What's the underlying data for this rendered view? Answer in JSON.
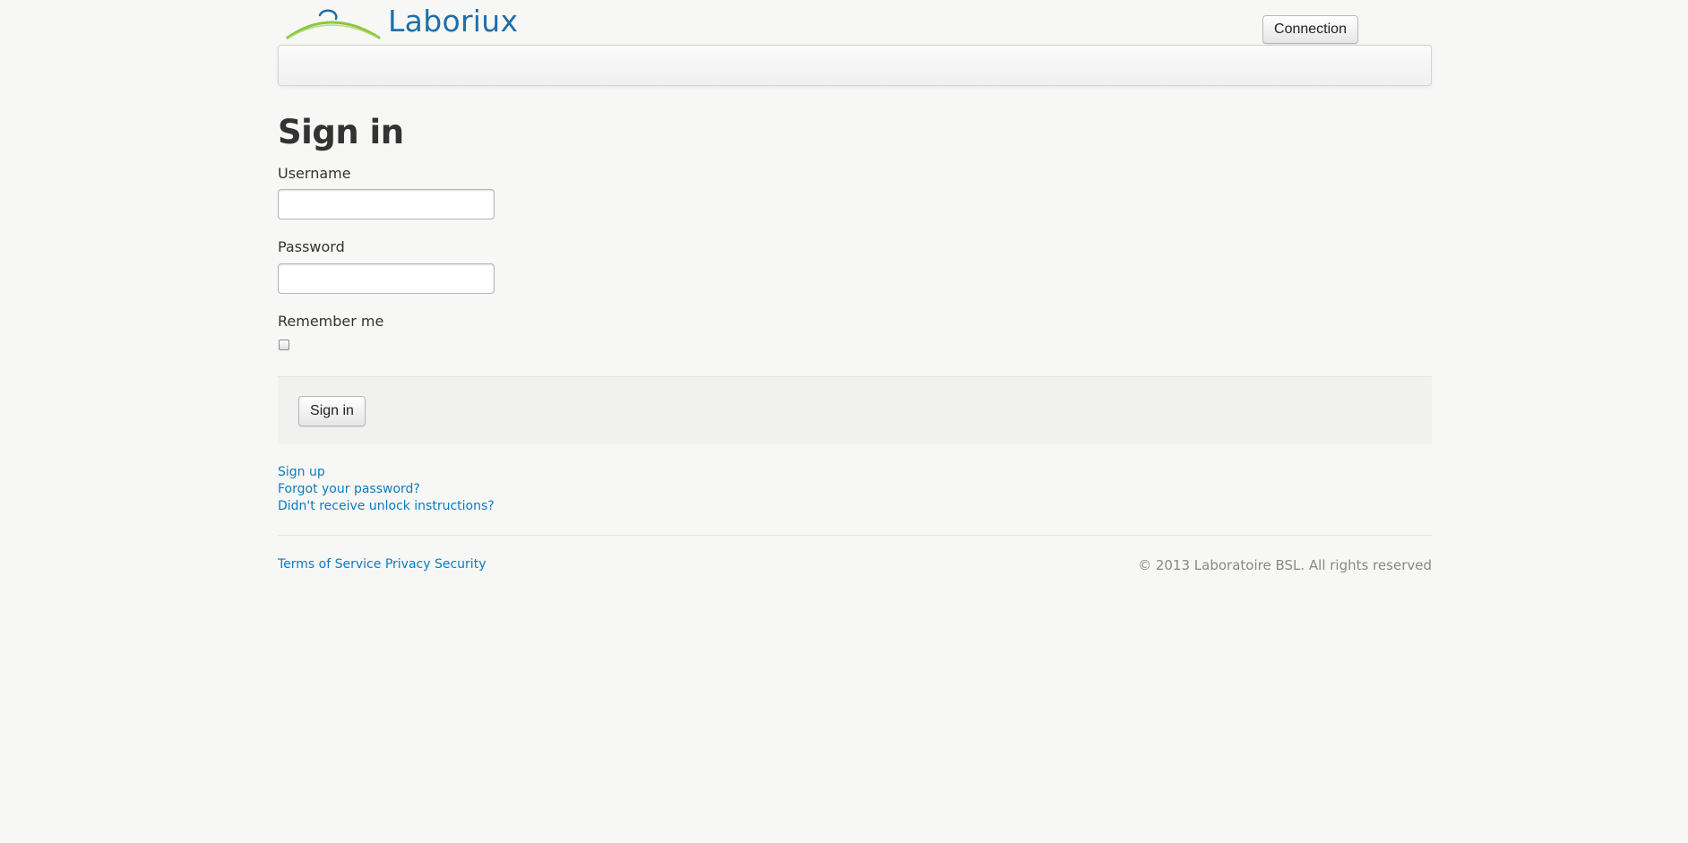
{
  "brand": {
    "name": "Laboriux",
    "colors": {
      "text_blue": "#1f6fa8",
      "arc_green": "#8cc63f",
      "ring_blue": "#1f6fa8"
    }
  },
  "header": {
    "connection_label": "Connection"
  },
  "form": {
    "title": "Sign in",
    "username_label": "Username",
    "username_value": "",
    "password_label": "Password",
    "password_value": "",
    "remember_label": "Remember me",
    "remember_checked": false,
    "submit_label": "Sign in"
  },
  "links": {
    "sign_up": "Sign up",
    "forgot_password": "Forgot your password?",
    "unlock_instructions": "Didn't receive unlock instructions?"
  },
  "footer": {
    "terms": "Terms of Service",
    "privacy": "Privacy",
    "security": "Security",
    "copyright": "© 2013 Laboratoire BSL. All rights reserved"
  },
  "colors": {
    "link": "#0a7cc1",
    "background": "#f7f7f5",
    "muted_text": "#888888"
  }
}
